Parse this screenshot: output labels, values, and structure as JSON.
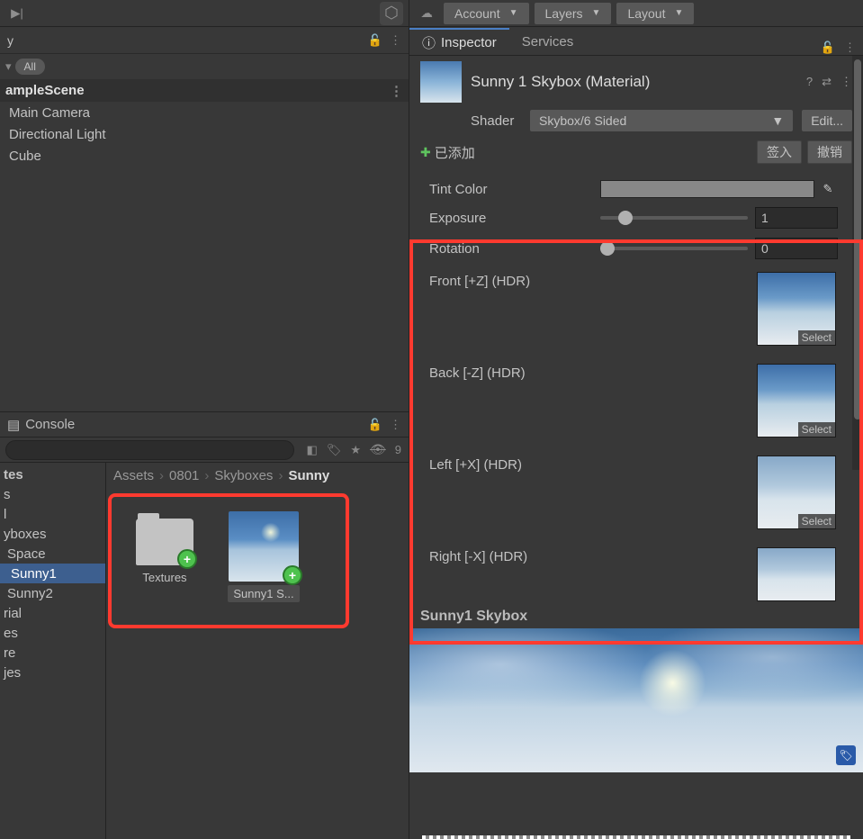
{
  "toolbar": {
    "account": "Account",
    "layers": "Layers",
    "layout": "Layout"
  },
  "hierarchy": {
    "tab": "y",
    "filter_all": "All",
    "scene": "ampleScene",
    "items": [
      "Main Camera",
      "Directional Light",
      "Cube"
    ]
  },
  "console": {
    "tab": "Console",
    "count9": "9"
  },
  "favorites": {
    "header": "tes",
    "items": [
      "s",
      "l",
      "yboxes",
      "Space",
      "Sunny1",
      "Sunny2",
      "rial",
      "es",
      "re",
      "jes"
    ]
  },
  "breadcrumb": [
    "Assets",
    "0801",
    "Skyboxes",
    "Sunny"
  ],
  "grid": {
    "textures": "Textures",
    "material": "Sunny1 S..."
  },
  "tabs": {
    "inspector": "Inspector",
    "services": "Services"
  },
  "material": {
    "title": "Sunny 1 Skybox (Material)",
    "shader_label": "Shader",
    "shader_value": "Skybox/6 Sided",
    "edit": "Edit...",
    "added": "已添加",
    "checkin": "签入",
    "revert": "撤销"
  },
  "props": {
    "tint": "Tint Color",
    "exposure": "Exposure",
    "exposure_val": "1",
    "rotation": "Rotation",
    "rotation_val": "0"
  },
  "textures": {
    "front": "Front [+Z]   (HDR)",
    "back": "Back [-Z]   (HDR)",
    "left": "Left [+X]   (HDR)",
    "right": "Right [-X]   (HDR)",
    "select": "Select"
  },
  "preview": {
    "title": "Sunny1 Skybox"
  }
}
